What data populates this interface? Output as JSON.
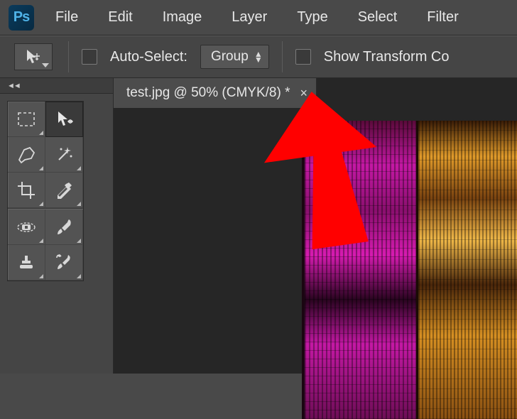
{
  "app": {
    "logo_text": "Ps"
  },
  "menubar": {
    "items": [
      "File",
      "Edit",
      "Image",
      "Layer",
      "Type",
      "Select",
      "Filter"
    ]
  },
  "options": {
    "auto_select_label": "Auto-Select:",
    "group_dropdown": "Group",
    "show_transform_label": "Show Transform Co"
  },
  "document": {
    "tab_title": "test.jpg @ 50% (CMYK/8) *",
    "tab_close": "×"
  },
  "collapse": {
    "arrows": "◄◄"
  },
  "tools": {
    "row1": [
      "marquee",
      "move"
    ],
    "row2": [
      "lasso",
      "magic-wand"
    ],
    "row3": [
      "crop",
      "eyedropper"
    ],
    "row4": [
      "healing-brush",
      "brush"
    ],
    "row5": [
      "stamp",
      "history-brush"
    ]
  }
}
